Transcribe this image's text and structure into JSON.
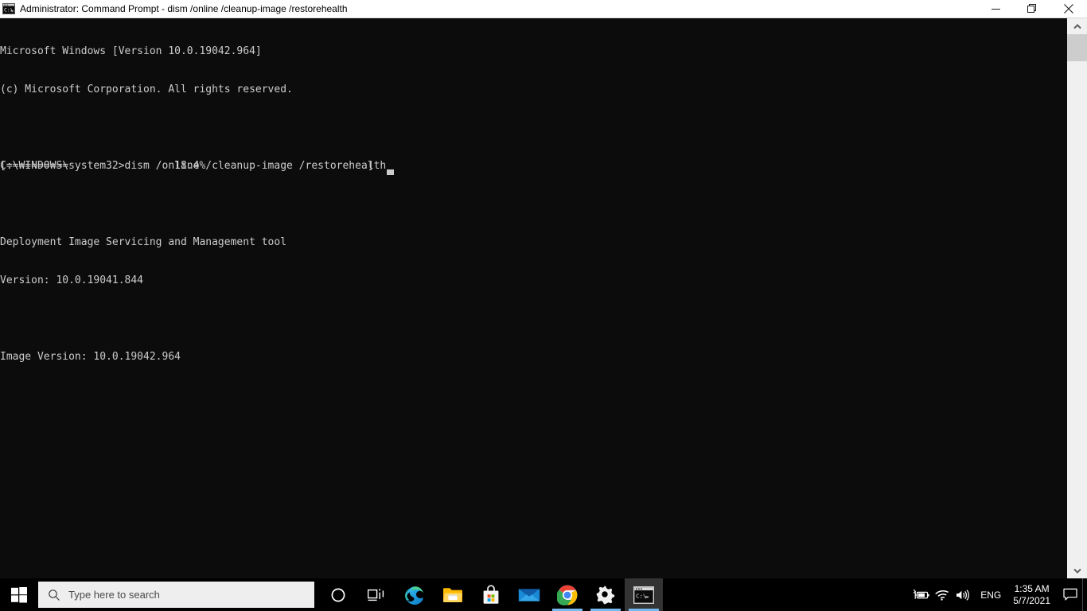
{
  "window": {
    "title": "Administrator: Command Prompt - dism  /online /cleanup-image /restorehealth",
    "icon_name": "cmd-prompt-icon",
    "minimize_label": "Minimize",
    "restore_label": "Restore Down",
    "close_label": "Close"
  },
  "terminal": {
    "background_color": "#0c0c0c",
    "foreground_color": "#cccccc",
    "lines": [
      "Microsoft Windows [Version 10.0.19042.964]",
      "(c) Microsoft Corporation. All rights reserved.",
      "",
      "C:\\WINDOWS\\system32>dism /online /cleanup-image /restorehealth",
      "",
      "Deployment Image Servicing and Management tool",
      "Version: 10.0.19041.844",
      "",
      "Image Version: 10.0.19042.964",
      ""
    ],
    "progress": {
      "open_bracket": "[",
      "filled": "==========",
      "gap_before_percent": "                 ",
      "percent_text": "18.4%",
      "gap_after_percent": "                          ",
      "close_bracket": "]",
      "percent_value": 18.4,
      "filled_count": 10,
      "total_cells": 60
    },
    "cursor": "_",
    "command_entered": "dism /online /cleanup-image /restorehealth",
    "prompt": "C:\\WINDOWS\\system32>"
  },
  "scrollbar": {
    "up_arrow_name": "scroll-up-arrow",
    "down_arrow_name": "scroll-down-arrow",
    "thumb_name": "scroll-thumb"
  },
  "taskbar": {
    "background_color": "#000000",
    "start_label": "Start",
    "search": {
      "placeholder": "Type here to search",
      "value": ""
    },
    "items": [
      {
        "name": "cortana",
        "label": "Cortana",
        "active": false,
        "running": false
      },
      {
        "name": "task-view",
        "label": "Task View",
        "active": false,
        "running": false
      },
      {
        "name": "microsoft-edge",
        "label": "Microsoft Edge",
        "active": false,
        "running": false
      },
      {
        "name": "file-explorer",
        "label": "File Explorer",
        "active": false,
        "running": false
      },
      {
        "name": "microsoft-store",
        "label": "Microsoft Store",
        "active": false,
        "running": false
      },
      {
        "name": "mail",
        "label": "Mail",
        "active": false,
        "running": false
      },
      {
        "name": "google-chrome",
        "label": "Google Chrome",
        "active": false,
        "running": true
      },
      {
        "name": "settings",
        "label": "Settings",
        "active": false,
        "running": true
      },
      {
        "name": "command-prompt",
        "label": "Command Prompt",
        "active": true,
        "running": true
      }
    ],
    "tray": {
      "icons": [
        {
          "name": "battery-charging-icon",
          "label": "Battery charging"
        },
        {
          "name": "wifi-icon",
          "label": "Network"
        },
        {
          "name": "volume-icon",
          "label": "Speakers"
        }
      ],
      "language": "ENG",
      "time": "1:35 AM",
      "date": "5/7/2021",
      "action_center_label": "Notifications",
      "show_desktop_label": "Show desktop"
    },
    "accent_color": "#76b9ed"
  }
}
